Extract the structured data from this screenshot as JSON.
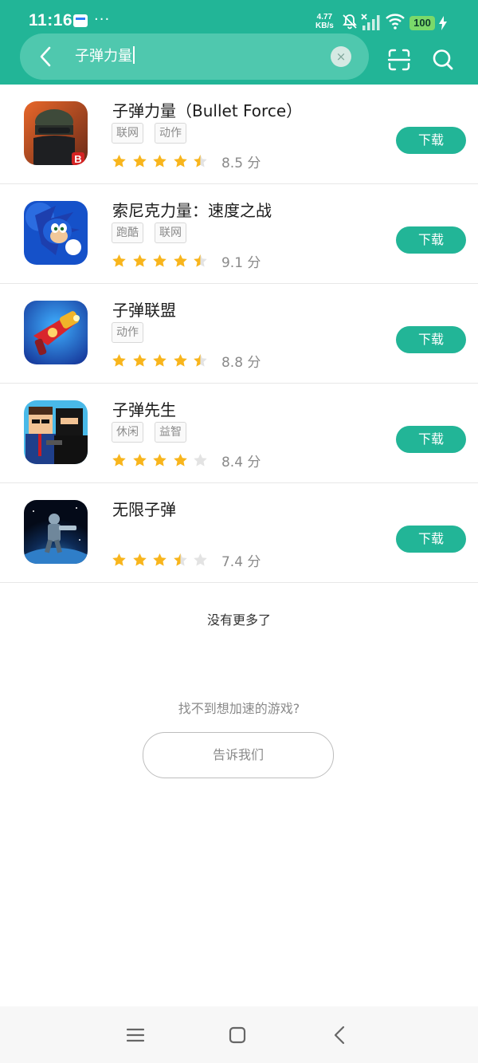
{
  "status_bar": {
    "time": "11:16",
    "dots": "···",
    "speed_value": "4.77",
    "speed_unit": "KB/s",
    "battery": "100"
  },
  "search": {
    "query": "子弹力量",
    "clear_symbol": "×",
    "icons": [
      "back-arrow-icon",
      "clear-icon",
      "scan-icon",
      "search-icon"
    ]
  },
  "colors": {
    "brand": "#22b597",
    "star": "#f8b51c",
    "star_empty": "#e3e3e3"
  },
  "results": [
    {
      "name": "子弹力量（Bullet Force）",
      "tags": [
        "联网",
        "动作"
      ],
      "stars": 4.5,
      "score": "8.5 分",
      "button": "下载"
    },
    {
      "name": "索尼克力量：速度之战",
      "tags": [
        "跑酷",
        "联网"
      ],
      "stars": 4.5,
      "score": "9.1 分",
      "button": "下载"
    },
    {
      "name": "子弹联盟",
      "tags": [
        "动作"
      ],
      "stars": 4.5,
      "score": "8.8 分",
      "button": "下载"
    },
    {
      "name": "子弹先生",
      "tags": [
        "休闲",
        "益智"
      ],
      "stars": 4,
      "score": "8.4 分",
      "button": "下载"
    },
    {
      "name": "无限子弹",
      "tags": [],
      "stars": 3.5,
      "score": "7.4 分",
      "button": "下载"
    }
  ],
  "footer": {
    "no_more": "没有更多了",
    "not_found": "找不到想加速的游戏?",
    "tell_us": "告诉我们"
  },
  "nav": {
    "icons": [
      "menu-icon",
      "home-icon",
      "back-icon"
    ]
  }
}
